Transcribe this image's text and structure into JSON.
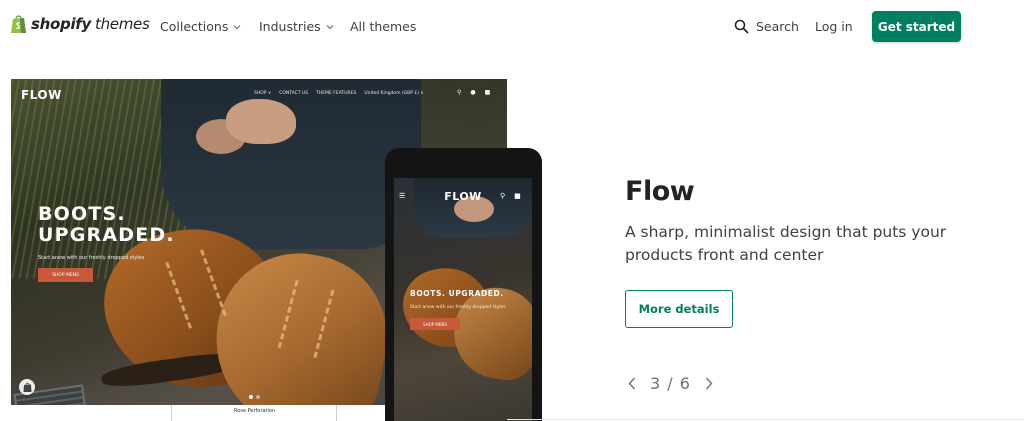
{
  "header": {
    "brand": "shopify",
    "brand_sub": "themes",
    "nav": [
      {
        "label": "Collections",
        "has_dropdown": true
      },
      {
        "label": "Industries",
        "has_dropdown": true
      },
      {
        "label": "All themes",
        "has_dropdown": false
      }
    ],
    "search_label": "Search",
    "login_label": "Log in",
    "cta_label": "Get started",
    "accent_color": "#008060"
  },
  "preview": {
    "desktop": {
      "brand": "FLOW",
      "menu": [
        "SHOP ∨",
        "CONTACT US",
        "THEME FEATURES",
        "United Kingdom (GBP £) ∨"
      ],
      "headline_line1": "BOOTS.",
      "headline_line2": "UPGRADED.",
      "tagline": "Start anew with our freshly dropped styles",
      "button": "SHOP MENS",
      "strip_items": [
        "Rose Perforation"
      ]
    },
    "mobile": {
      "brand": "FLOW",
      "headline": "BOOTS. UPGRADED.",
      "tagline": "Start anew with our freshly dropped styles",
      "button": "SHOP MENS"
    }
  },
  "theme": {
    "name": "Flow",
    "description": "A sharp, minimalist design that puts your products front and center",
    "details_label": "More details",
    "pager": "3 / 6"
  }
}
